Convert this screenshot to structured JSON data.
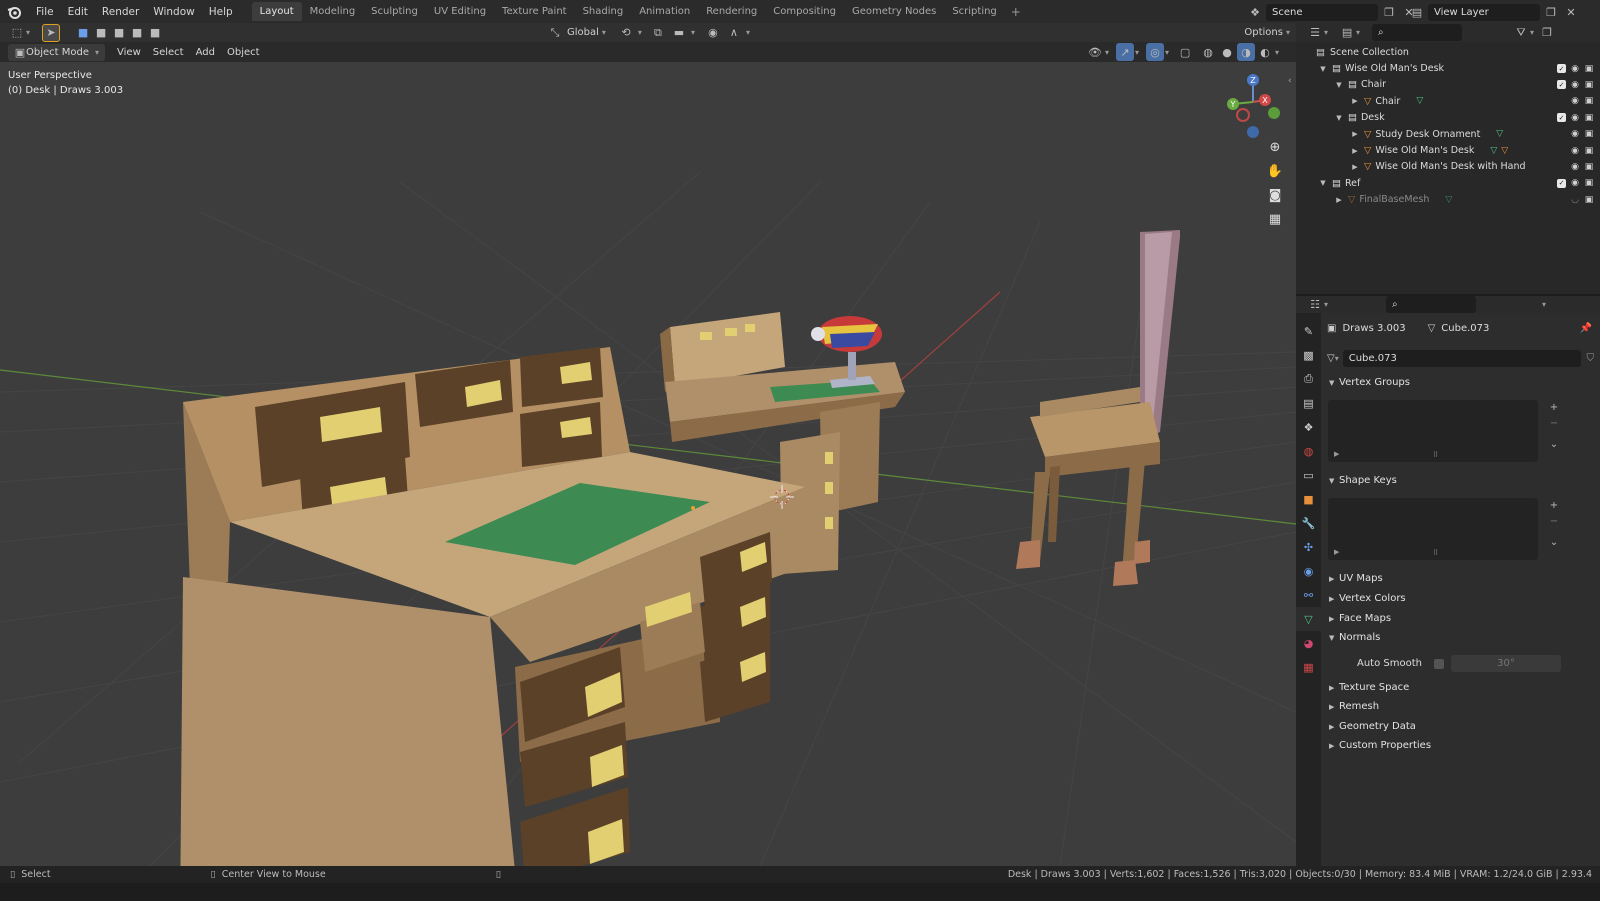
{
  "menu": [
    "File",
    "Edit",
    "Render",
    "Window",
    "Help"
  ],
  "workspaces": [
    {
      "label": "Layout",
      "active": true
    },
    {
      "label": "Modeling"
    },
    {
      "label": "Sculpting"
    },
    {
      "label": "UV Editing"
    },
    {
      "label": "Texture Paint"
    },
    {
      "label": "Shading"
    },
    {
      "label": "Animation"
    },
    {
      "label": "Rendering"
    },
    {
      "label": "Compositing"
    },
    {
      "label": "Geometry Nodes"
    },
    {
      "label": "Scripting"
    }
  ],
  "topbar": {
    "scene": "Scene",
    "view_layer": "View Layer"
  },
  "header": {
    "mode": "Object Mode",
    "menus": [
      "View",
      "Select",
      "Add",
      "Object"
    ],
    "orientation": "Global",
    "options": "Options"
  },
  "viewport": {
    "perspective": "User Perspective",
    "info": "(0) Desk | Draws 3.003",
    "gizmo": {
      "x": "X",
      "y": "Y",
      "z": "Z"
    }
  },
  "outliner": {
    "rows": [
      {
        "label": "Scene Collection",
        "indent": 0,
        "type": "scene"
      },
      {
        "label": "Wise Old Man's Desk",
        "indent": 1,
        "type": "collection"
      },
      {
        "label": "Chair",
        "indent": 2,
        "type": "collection"
      },
      {
        "label": "Chair",
        "indent": 3,
        "type": "object"
      },
      {
        "label": "Desk",
        "indent": 2,
        "type": "collection"
      },
      {
        "label": "Study Desk Ornament",
        "indent": 3,
        "type": "object"
      },
      {
        "label": "Wise Old Man's Desk",
        "indent": 3,
        "type": "object"
      },
      {
        "label": "Wise Old Man's Desk with Hand",
        "indent": 3,
        "type": "object"
      },
      {
        "label": "Ref",
        "indent": 1,
        "type": "collection"
      },
      {
        "label": "FinalBaseMesh",
        "indent": 2,
        "type": "object-dim"
      }
    ]
  },
  "properties": {
    "object": "Draws 3.003",
    "mesh": "Cube.073",
    "mesh_field": "Cube.073",
    "panels": {
      "vertex_groups": "Vertex Groups",
      "shape_keys": "Shape Keys",
      "uv_maps": "UV Maps",
      "vertex_colors": "Vertex Colors",
      "face_maps": "Face Maps",
      "normals": "Normals",
      "auto_smooth": "Auto Smooth",
      "auto_smooth_angle": "30°",
      "texture_space": "Texture Space",
      "remesh": "Remesh",
      "geometry_data": "Geometry Data",
      "custom_properties": "Custom Properties"
    }
  },
  "status": {
    "left": "Select",
    "middle": "Center View to Mouse",
    "right": "Desk | Draws 3.003 | Verts:1,602 | Faces:1,526 | Tris:3,020 | Objects:0/30 | Memory: 83.4 MiB | VRAM: 1.2/24.0 GiB | 2.93.4"
  },
  "colors": {
    "wood": "#a98a62",
    "wood_dark": "#6e5336",
    "drawer": "#5a4128",
    "handle": "#e2cf72",
    "mat": "#3d8a52",
    "grid_bg": "#3d3d3d"
  }
}
